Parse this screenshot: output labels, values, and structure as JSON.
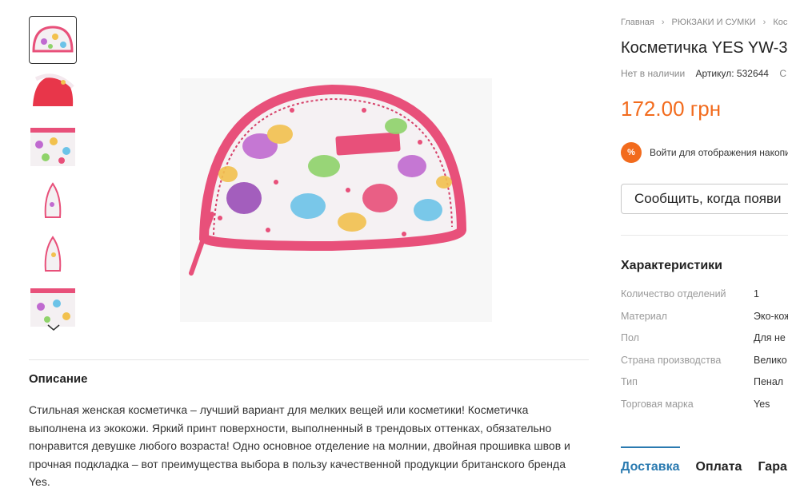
{
  "breadcrumb": [
    "Главная",
    "РЮКЗАКИ И СУМКИ",
    "Кос"
  ],
  "product": {
    "title": "Косметичка YES YW-3",
    "availability": "Нет в наличии",
    "sku_label": "Артикул:",
    "sku": "532644",
    "sku_more": "С",
    "price": "172.00 грн",
    "promo_badge": "%",
    "promo_text": "Войти для отображения накопи",
    "notify_button": "Сообщить, когда появи"
  },
  "characteristics": {
    "title": "Характеристики",
    "rows": [
      {
        "key": "Количество отделений",
        "value": "1"
      },
      {
        "key": "Материал",
        "value": "Эко-кож"
      },
      {
        "key": "Пол",
        "value": "Для не"
      },
      {
        "key": "Страна производства",
        "value": "Велико"
      },
      {
        "key": "Тип",
        "value": "Пенал"
      },
      {
        "key": "Торговая марка",
        "value": "Yes"
      }
    ]
  },
  "tabs": [
    "Доставка",
    "Оплата",
    "Гаран"
  ],
  "description": {
    "title": "Описание",
    "text": "Стильная женская косметичка – лучший вариант для мелких вещей или косметики! Косметичка выполнена из экокожи. Яркий принт поверхности, выполненный в трендовых оттенках, обязательно понравится девушке любого возраста! Одно основное отделение на молнии, двойная прошивка швов и прочная подкладка – вот преимущества выбора в пользу качественной продукции британского бренда Yes."
  },
  "colors": {
    "accent": "#f26b1d",
    "link": "#2a7ab0",
    "bag_pink": "#e8507a"
  },
  "icons": {
    "thumb_down": "chevron-down-icon",
    "crumb_sep": "chevron-right-icon"
  }
}
